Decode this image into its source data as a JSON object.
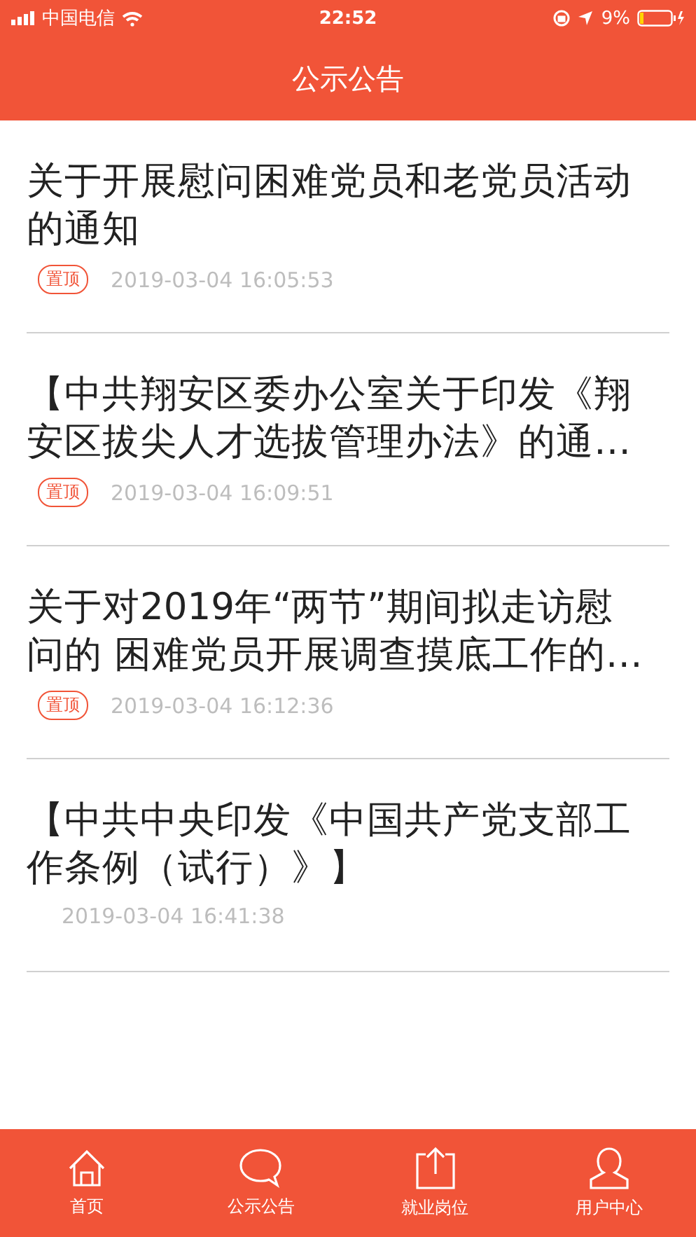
{
  "status_bar": {
    "carrier": "中国电信",
    "time": "22:52",
    "battery": "9%"
  },
  "header": {
    "title": "公示公告"
  },
  "notices": [
    {
      "title_lines": [
        "关于开展慰问困难党员和老党员活动",
        "的通知"
      ],
      "pinned": true,
      "badge": "置顶",
      "date": "2019-03-04 16:05:53"
    },
    {
      "title_lines": [
        "【中共翔安区委办公室关于印发《翔",
        "安区拔尖人才选拔管理办法》的通…"
      ],
      "pinned": true,
      "badge": "置顶",
      "date": "2019-03-04 16:09:51"
    },
    {
      "title_lines": [
        "关于对2019年“两节”期间拟走访慰",
        "问的 困难党员开展调查摸底工作的…"
      ],
      "pinned": true,
      "badge": "置顶",
      "date": "2019-03-04 16:12:36"
    },
    {
      "title_lines": [
        "【中共中央印发《中国共产党支部工",
        "作条例（试行）》】"
      ],
      "pinned": false,
      "date": "2019-03-04 16:41:38"
    }
  ],
  "tab_bar": [
    {
      "label": "首页"
    },
    {
      "label": "公示公告"
    },
    {
      "label": "就业岗位"
    },
    {
      "label": "用户中心"
    }
  ]
}
